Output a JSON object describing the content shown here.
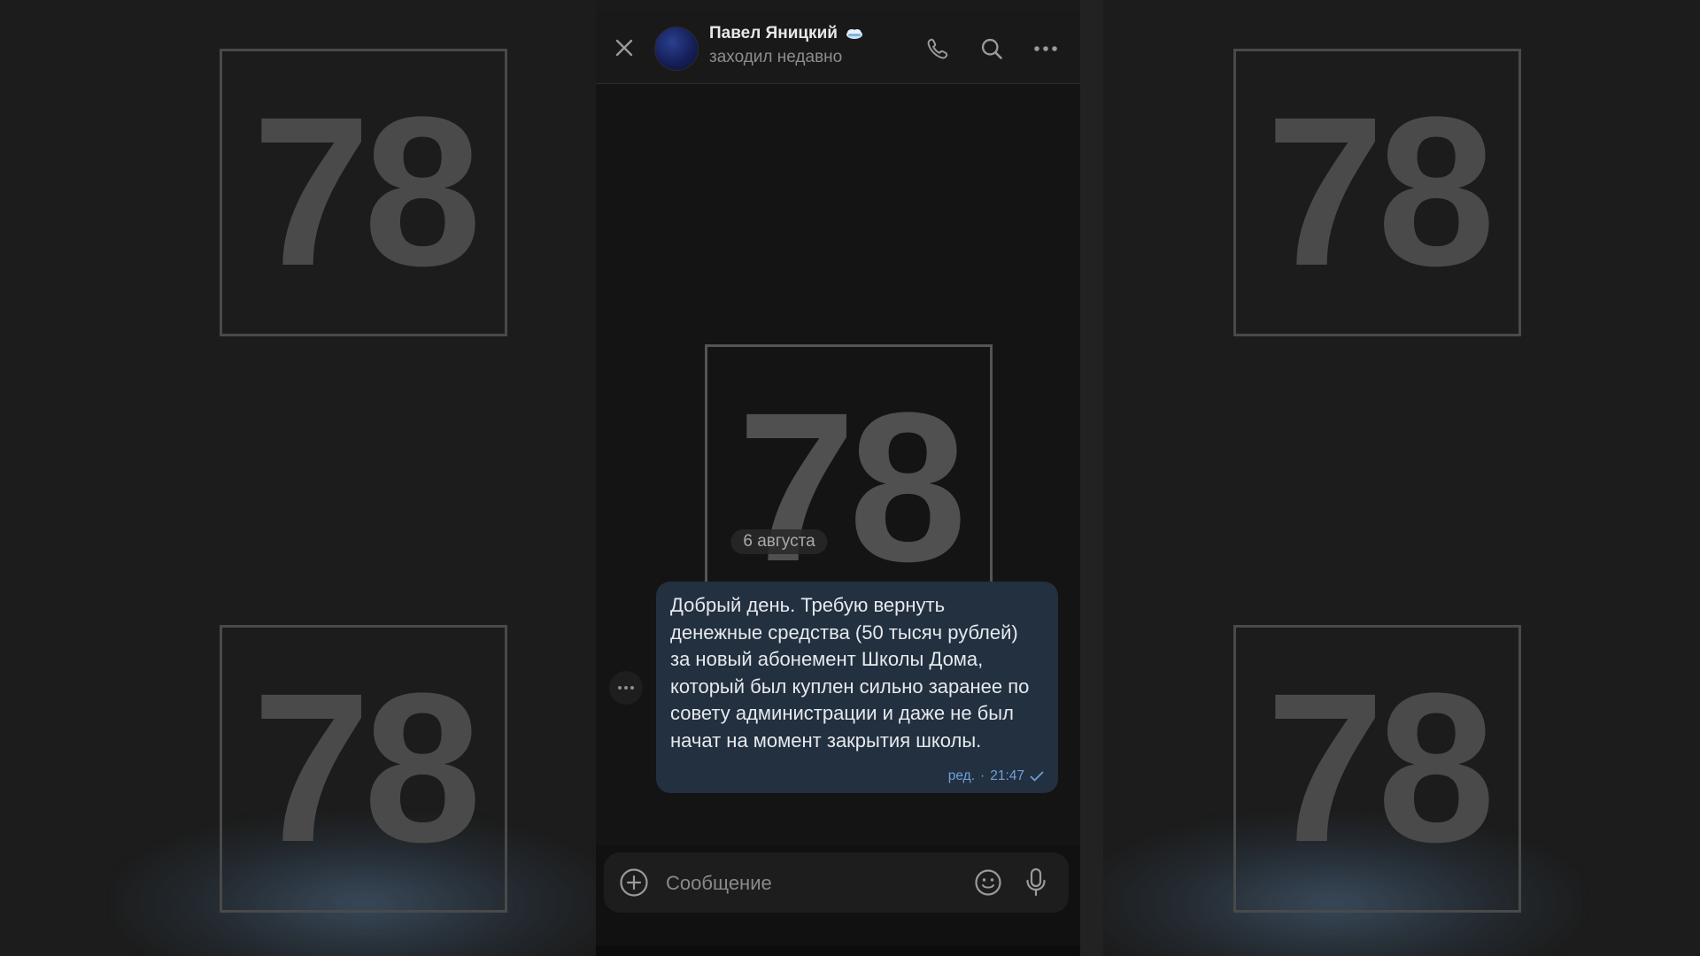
{
  "watermark": {
    "text": "78"
  },
  "header": {
    "contact_name": "Павел Яницкий",
    "status": "заходил недавно",
    "icons": [
      "close-icon",
      "phone-icon",
      "search-icon",
      "more-icon"
    ]
  },
  "chat": {
    "date_separator": "6 августа",
    "messages": [
      {
        "text": "Добрый день. Требую вернуть денежные средства (50 тысяч рублей) за новый абонемент Школы Дома, который был куплен сильно заранее по совету администрации и даже не был начат на момент закрытия школы.",
        "edited_label": "ред.",
        "separator": "·",
        "time": "21:47",
        "status_icon": "check-icon"
      }
    ]
  },
  "composer": {
    "placeholder": "Сообщение",
    "icons": [
      "add-icon",
      "emoji-icon",
      "mic-icon"
    ]
  },
  "colors": {
    "bubble": "#22303f",
    "meta_accent": "#6ea0d8",
    "background": "#141414"
  }
}
